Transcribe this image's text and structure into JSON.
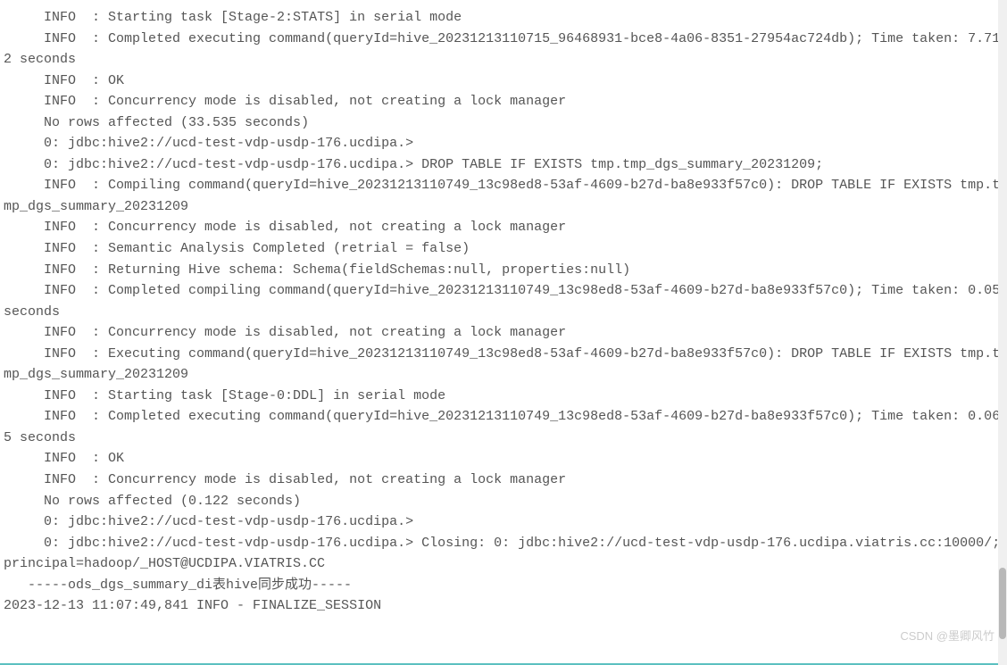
{
  "log": {
    "lines": [
      "     INFO  : Starting task [Stage-2:STATS] in serial mode",
      "     INFO  : Completed executing command(queryId=hive_20231213110715_96468931-bce8-4a06-8351-27954ac724db); Time taken: 7.712 seconds",
      "     INFO  : OK",
      "     INFO  : Concurrency mode is disabled, not creating a lock manager",
      "     No rows affected (33.535 seconds)",
      "     0: jdbc:hive2://ucd-test-vdp-usdp-176.ucdipa.>",
      "     0: jdbc:hive2://ucd-test-vdp-usdp-176.ucdipa.> DROP TABLE IF EXISTS tmp.tmp_dgs_summary_20231209;",
      "     INFO  : Compiling command(queryId=hive_20231213110749_13c98ed8-53af-4609-b27d-ba8e933f57c0): DROP TABLE IF EXISTS tmp.tmp_dgs_summary_20231209",
      "     INFO  : Concurrency mode is disabled, not creating a lock manager",
      "     INFO  : Semantic Analysis Completed (retrial = false)",
      "     INFO  : Returning Hive schema: Schema(fieldSchemas:null, properties:null)",
      "     INFO  : Completed compiling command(queryId=hive_20231213110749_13c98ed8-53af-4609-b27d-ba8e933f57c0); Time taken: 0.05 seconds",
      "     INFO  : Concurrency mode is disabled, not creating a lock manager",
      "     INFO  : Executing command(queryId=hive_20231213110749_13c98ed8-53af-4609-b27d-ba8e933f57c0): DROP TABLE IF EXISTS tmp.tmp_dgs_summary_20231209",
      "     INFO  : Starting task [Stage-0:DDL] in serial mode",
      "     INFO  : Completed executing command(queryId=hive_20231213110749_13c98ed8-53af-4609-b27d-ba8e933f57c0); Time taken: 0.065 seconds",
      "     INFO  : OK",
      "     INFO  : Concurrency mode is disabled, not creating a lock manager",
      "     No rows affected (0.122 seconds)",
      "     0: jdbc:hive2://ucd-test-vdp-usdp-176.ucdipa.>",
      "     0: jdbc:hive2://ucd-test-vdp-usdp-176.ucdipa.> Closing: 0: jdbc:hive2://ucd-test-vdp-usdp-176.ucdipa.viatris.cc:10000/;principal=hadoop/_HOST@UCDIPA.VIATRIS.CC",
      "   -----ods_dgs_summary_di表hive同步成功-----",
      "2023-12-13 11:07:49,841 INFO - FINALIZE_SESSION"
    ]
  },
  "watermark": "CSDN @墨卿风竹"
}
